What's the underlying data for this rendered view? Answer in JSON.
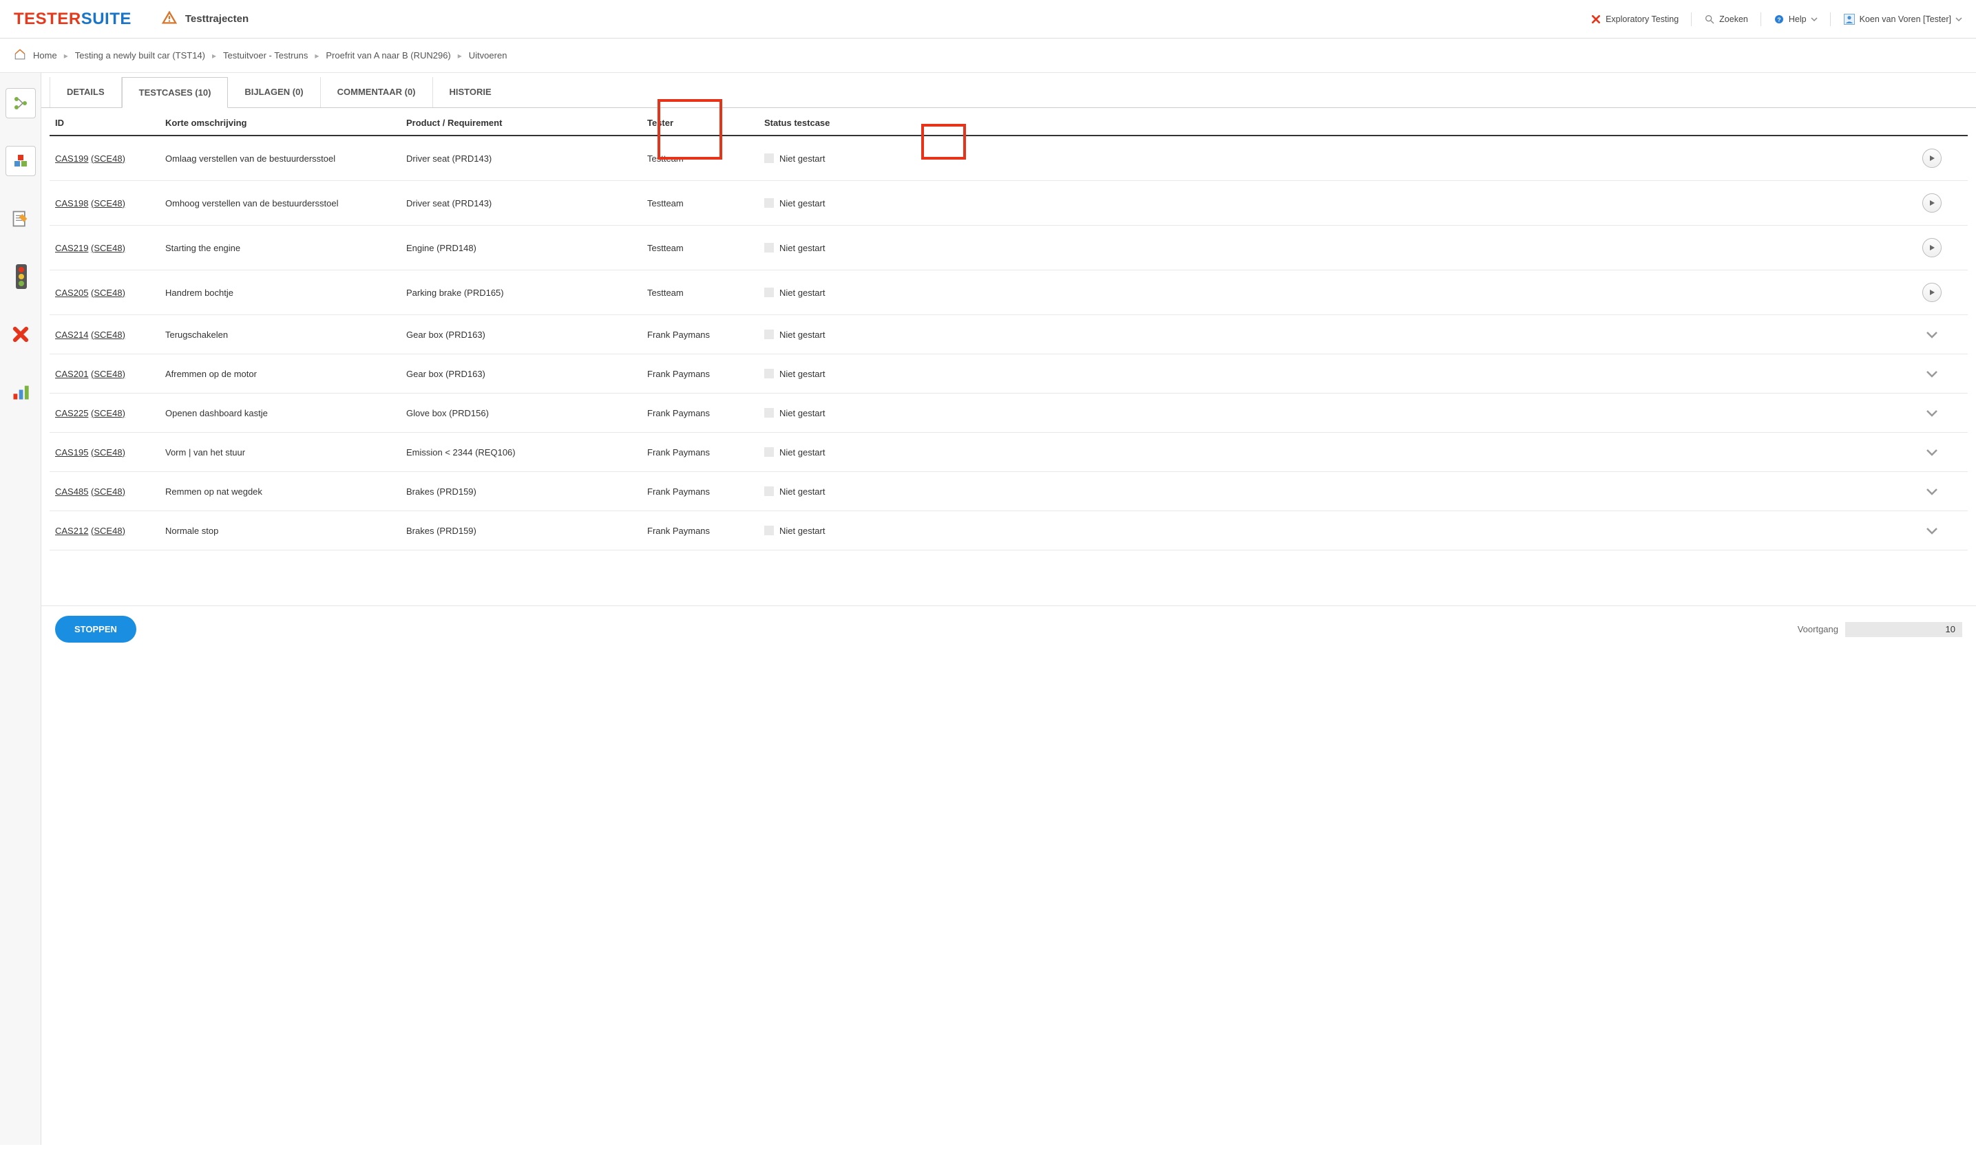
{
  "header": {
    "logo_left": "TESTER",
    "logo_right": "SUITE",
    "title": "Testtrajecten",
    "exploratory": "Exploratory Testing",
    "search": "Zoeken",
    "help": "Help",
    "user": "Koen van Voren [Tester]"
  },
  "breadcrumb": {
    "home": "Home",
    "items": [
      "Testing a newly built car (TST14)",
      "Testuitvoer - Testruns",
      "Proefrit van A naar B (RUN296)",
      "Uitvoeren"
    ]
  },
  "tabs": [
    {
      "label": "DETAILS",
      "active": false
    },
    {
      "label": "TESTCASES (10)",
      "active": true
    },
    {
      "label": "BIJLAGEN (0)",
      "active": false
    },
    {
      "label": "COMMENTAAR (0)",
      "active": false
    },
    {
      "label": "HISTORIE",
      "active": false
    }
  ],
  "columns": {
    "id": "ID",
    "desc": "Korte omschrijving",
    "prod": "Product / Requirement",
    "tester": "Tester",
    "status": "Status testcase"
  },
  "rows": [
    {
      "cas": "CAS199",
      "sce": "(SCE48)",
      "desc": "Omlaag verstellen van de bestuurdersstoel",
      "prod": "Driver seat (PRD143)",
      "tester": "Testteam",
      "status": "Niet gestart",
      "action": "play"
    },
    {
      "cas": "CAS198",
      "sce": "(SCE48)",
      "desc": "Omhoog verstellen van de bestuurdersstoel",
      "prod": "Driver seat (PRD143)",
      "tester": "Testteam",
      "status": "Niet gestart",
      "action": "play"
    },
    {
      "cas": "CAS219",
      "sce": "(SCE48)",
      "desc": "Starting the engine",
      "prod": "Engine (PRD148)",
      "tester": "Testteam",
      "status": "Niet gestart",
      "action": "play"
    },
    {
      "cas": "CAS205",
      "sce": "(SCE48)",
      "desc": "Handrem bochtje",
      "prod": "Parking brake (PRD165)",
      "tester": "Testteam",
      "status": "Niet gestart",
      "action": "play"
    },
    {
      "cas": "CAS214",
      "sce": "(SCE48)",
      "desc": "Terugschakelen",
      "prod": "Gear box (PRD163)",
      "tester": "Frank Paymans",
      "status": "Niet gestart",
      "action": "chevron"
    },
    {
      "cas": "CAS201",
      "sce": "(SCE48)",
      "desc": "Afremmen op de motor",
      "prod": "Gear box (PRD163)",
      "tester": "Frank Paymans",
      "status": "Niet gestart",
      "action": "chevron"
    },
    {
      "cas": "CAS225",
      "sce": "(SCE48)",
      "desc": "Openen dashboard kastje",
      "prod": "Glove box (PRD156)",
      "tester": "Frank Paymans",
      "status": "Niet gestart",
      "action": "chevron"
    },
    {
      "cas": "CAS195",
      "sce": "(SCE48)",
      "desc": "Vorm | van het stuur",
      "prod": "Emission < 2344 (REQ106)",
      "tester": "Frank Paymans",
      "status": "Niet gestart",
      "action": "chevron"
    },
    {
      "cas": "CAS485",
      "sce": "(SCE48)",
      "desc": "Remmen op nat wegdek",
      "prod": "Brakes (PRD159)",
      "tester": "Frank Paymans",
      "status": "Niet gestart",
      "action": "chevron"
    },
    {
      "cas": "CAS212",
      "sce": "(SCE48)",
      "desc": "Normale stop",
      "prod": "Brakes (PRD159)",
      "tester": "Frank Paymans",
      "status": "Niet gestart",
      "action": "chevron"
    }
  ],
  "footer": {
    "stoppen": "STOPPEN",
    "voortgang_label": "Voortgang",
    "voortgang_value": "10"
  }
}
